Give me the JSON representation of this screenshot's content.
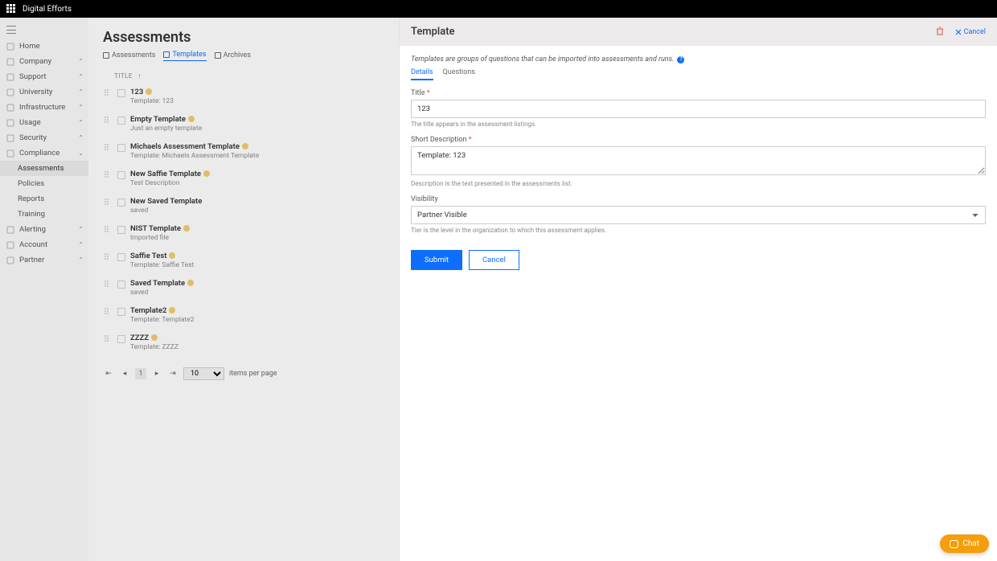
{
  "topbar": {
    "brand": "Digital Efforts"
  },
  "sidebar": {
    "items": [
      {
        "label": "Home",
        "expandable": false
      },
      {
        "label": "Company",
        "expandable": true
      },
      {
        "label": "Support",
        "expandable": true
      },
      {
        "label": "University",
        "expandable": true
      },
      {
        "label": "Infrastructure",
        "expandable": true
      },
      {
        "label": "Usage",
        "expandable": true
      },
      {
        "label": "Security",
        "expandable": true
      },
      {
        "label": "Compliance",
        "expandable": true,
        "expanded": true,
        "children": [
          {
            "label": "Assessments",
            "active": true
          },
          {
            "label": "Policies"
          },
          {
            "label": "Reports"
          },
          {
            "label": "Training"
          }
        ]
      },
      {
        "label": "Alerting",
        "expandable": true
      },
      {
        "label": "Account",
        "expandable": true
      },
      {
        "label": "Partner",
        "expandable": true
      }
    ]
  },
  "page": {
    "title": "Assessments",
    "tabs": [
      {
        "label": "Assessments"
      },
      {
        "label": "Templates",
        "active": true
      },
      {
        "label": "Archives"
      }
    ],
    "list_header": "TITLE",
    "templates": [
      {
        "title": "123",
        "sub": "Template: 123"
      },
      {
        "title": "Empty Template",
        "sub": "Just an empty template"
      },
      {
        "title": "Michaels Assessment Template",
        "sub": "Template: Michaels Assessment Template"
      },
      {
        "title": "New Saffie Template",
        "sub": "Test Description"
      },
      {
        "title": "New Saved Template",
        "sub": "saved",
        "no_badge": true
      },
      {
        "title": "NIST Template",
        "sub": "Imported file"
      },
      {
        "title": "Saffie Test",
        "sub": "Template: Saffie Test"
      },
      {
        "title": "Saved Template",
        "sub": "saved"
      },
      {
        "title": "Template2",
        "sub": "Template: Template2"
      },
      {
        "title": "ZZZZ",
        "sub": "Template: ZZZZ"
      }
    ],
    "pager": {
      "page": "1",
      "size": "10",
      "suffix": "items per page"
    }
  },
  "panel": {
    "title": "Template",
    "cancel_label": "Cancel",
    "intro": "Templates are groups of questions that can be imported into assessments and runs.",
    "tabs": {
      "details": "Details",
      "questions": "Questions"
    },
    "form": {
      "title_label": "Title",
      "title_value": "123",
      "title_hint": "The title appears in the assessment listings.",
      "desc_label": "Short Description",
      "desc_value": "Template: 123",
      "desc_hint": "Description is the text presented in the assessments list.",
      "vis_label": "Visibility",
      "vis_value": "Partner Visible",
      "vis_hint": "Tier is the level in the organization to which this assessment applies.",
      "submit": "Submit",
      "cancel": "Cancel"
    }
  },
  "chat": {
    "label": "Chat"
  }
}
